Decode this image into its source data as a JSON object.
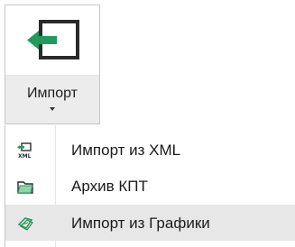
{
  "ribbon": {
    "button_label": "Импорт",
    "icon": "import-arrow-icon"
  },
  "menu": {
    "items": [
      {
        "label": "Импорт из XML",
        "icon": "xml-import-icon"
      },
      {
        "label": "Архив КПТ",
        "icon": "folder-archive-icon"
      },
      {
        "label": "Импорт из Графики",
        "icon": "graphics-import-icon",
        "highlighted": true
      }
    ]
  },
  "colors": {
    "accent_green": "#1f9b5a",
    "icon_dark": "#2a2a2a",
    "hover_bg": "#e7e7e7"
  }
}
